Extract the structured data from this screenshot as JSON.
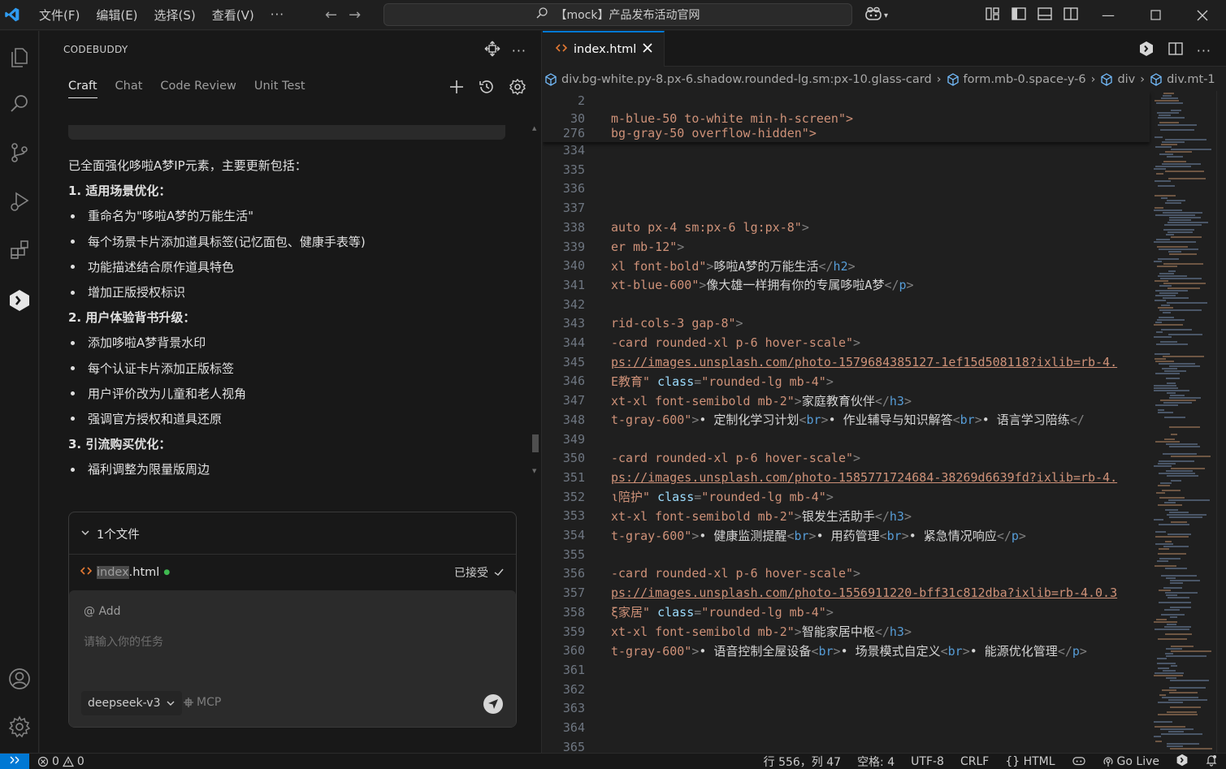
{
  "titlebar": {
    "menus": [
      "文件(F)",
      "编辑(E)",
      "选择(S)",
      "查看(V)"
    ],
    "more": "···",
    "search_text": "【mock】产品发布活动官网",
    "icons": [
      "vscode-logo",
      "back-arrow",
      "forward-arrow",
      "search",
      "copilot",
      "layout-customize",
      "toggle-primary-sidebar",
      "toggle-panel",
      "toggle-secondary-sidebar"
    ],
    "window_controls": [
      "minimize",
      "maximize",
      "close"
    ]
  },
  "activity_bar": {
    "items": [
      "explorer",
      "search",
      "source-control",
      "run-and-debug",
      "extensions",
      "codebuddy",
      "accounts",
      "manage"
    ]
  },
  "panel": {
    "title": "CODEBUDDY",
    "tabs": [
      "Craft",
      "Chat",
      "Code Review",
      "Unit Test"
    ],
    "active_tab": "Craft",
    "message": {
      "intro": "已全面强化哆啦A梦IP元素，主要更新包括：",
      "sections": [
        {
          "heading": "1. 适用场景优化：",
          "items": [
            "重命名为\"哆啦A梦的万能生活\"",
            "每个场景卡片添加道具标签(记忆面包、健康手表等)",
            "功能描述结合原作道具特色",
            "增加正版授权标识"
          ]
        },
        {
          "heading": "2. 用户体验背书升级：",
          "items": [
            "添加哆啦A梦背景水印",
            "每个认证卡片添加正版标签",
            "用户评价改为儿童和老人视角",
            "强调官方授权和道具还原"
          ]
        },
        {
          "heading": "3. 引流购买优化：",
          "items": [
            "福利调整为限量版周边"
          ]
        }
      ]
    },
    "files": {
      "header": "1个文件",
      "file_name_highlight": "index",
      "file_name_rest": ".html",
      "status": "已接受"
    },
    "input": {
      "at_label": "@ Add",
      "placeholder": "请输入你的任务",
      "model": "deepseek-v3",
      "mcp": "MCP"
    }
  },
  "editor": {
    "tab_label": "index.html",
    "breadcrumb": [
      "div.bg-white.py-8.px-6.shadow.rounded-lg.sm:px-10.glass-card",
      "form.mb-0.space-y-6",
      "div",
      "div.mt-1"
    ],
    "sticky": [
      {
        "ln": "2",
        "text": ""
      },
      {
        "ln": "30",
        "text": "m-blue-50 to-white min-h-screen\">"
      },
      {
        "ln": "276",
        "text": "bg-gray-50 overflow-hidden\">"
      }
    ],
    "lines": [
      {
        "ln": "334",
        "parts": []
      },
      {
        "ln": "335",
        "parts": []
      },
      {
        "ln": "336",
        "parts": []
      },
      {
        "ln": "337",
        "parts": []
      },
      {
        "ln": "338",
        "parts": [
          [
            "str",
            "auto px-4 sm:px-6 lg:px-8\""
          ],
          [
            "punc",
            ">"
          ]
        ]
      },
      {
        "ln": "339",
        "parts": [
          [
            "str",
            "er mb-12\""
          ],
          [
            "punc",
            ">"
          ]
        ]
      },
      {
        "ln": "340",
        "parts": [
          [
            "str",
            "xl font-bold\""
          ],
          [
            "punc",
            ">"
          ],
          [
            "text",
            "哆啦A梦的万能生活"
          ],
          [
            "punc",
            "</"
          ],
          [
            "tag",
            "h2"
          ],
          [
            "punc",
            ">"
          ]
        ]
      },
      {
        "ln": "341",
        "parts": [
          [
            "str",
            "xt-blue-600\""
          ],
          [
            "punc",
            ">"
          ],
          [
            "text",
            "像大雄一样拥有你的专属哆啦A梦"
          ],
          [
            "punc",
            "</"
          ],
          [
            "tag",
            "p"
          ],
          [
            "punc",
            ">"
          ]
        ]
      },
      {
        "ln": "342",
        "parts": []
      },
      {
        "ln": "343",
        "parts": [
          [
            "str",
            "rid-cols-3 gap-8\""
          ],
          [
            "punc",
            ">"
          ]
        ]
      },
      {
        "ln": "344",
        "parts": [
          [
            "str",
            "-card rounded-xl p-6 hover-scale\""
          ],
          [
            "punc",
            ">"
          ]
        ]
      },
      {
        "ln": "345",
        "parts": [
          [
            "link",
            "ps://images.unsplash.com/photo-1579684385127-1ef15d508118?ixlib=rb-4."
          ]
        ]
      },
      {
        "ln": "346",
        "parts": [
          [
            "str",
            "Ε教育\" "
          ],
          [
            "attr",
            "class"
          ],
          [
            "punc",
            "="
          ],
          [
            "str",
            "\"rounded-lg mb-4\""
          ],
          [
            "punc",
            ">"
          ]
        ]
      },
      {
        "ln": "347",
        "parts": [
          [
            "str",
            "xt-xl font-semibold mb-2\""
          ],
          [
            "punc",
            ">"
          ],
          [
            "text",
            "家庭教育伙伴"
          ],
          [
            "punc",
            "</"
          ],
          [
            "tag",
            "h3"
          ],
          [
            "punc",
            ">"
          ]
        ]
      },
      {
        "ln": "348",
        "parts": [
          [
            "str",
            "t-gray-600\""
          ],
          [
            "punc",
            ">"
          ],
          [
            "text",
            "• 定制化学习计划"
          ],
          [
            "punc",
            "<"
          ],
          [
            "tag",
            "br"
          ],
          [
            "punc",
            ">"
          ],
          [
            "text",
            "• 作业辅导与知识解答"
          ],
          [
            "punc",
            "<"
          ],
          [
            "tag",
            "br"
          ],
          [
            "punc",
            ">"
          ],
          [
            "text",
            "• 语言学习陪练"
          ],
          [
            "punc",
            "</"
          ]
        ]
      },
      {
        "ln": "349",
        "parts": []
      },
      {
        "ln": "350",
        "parts": [
          [
            "str",
            "-card rounded-xl p-6 hover-scale\""
          ],
          [
            "punc",
            ">"
          ]
        ]
      },
      {
        "ln": "351",
        "parts": [
          [
            "link",
            "ps://images.unsplash.com/photo-1585771724684-38269d6639fd?ixlib=rb-4."
          ]
        ]
      },
      {
        "ln": "352",
        "parts": [
          [
            "str",
            "ι陪护\" "
          ],
          [
            "attr",
            "class"
          ],
          [
            "punc",
            "="
          ],
          [
            "str",
            "\"rounded-lg mb-4\""
          ],
          [
            "punc",
            ">"
          ]
        ]
      },
      {
        "ln": "353",
        "parts": [
          [
            "str",
            "xt-xl font-semibold mb-2\""
          ],
          [
            "punc",
            ">"
          ],
          [
            "text",
            "银发生活助手"
          ],
          [
            "punc",
            "</"
          ],
          [
            "tag",
            "h3"
          ],
          [
            "punc",
            ">"
          ]
        ]
      },
      {
        "ln": "354",
        "parts": [
          [
            "str",
            "t-gray-600\""
          ],
          [
            "punc",
            ">"
          ],
          [
            "text",
            "• 健康监测提醒"
          ],
          [
            "punc",
            "<"
          ],
          [
            "tag",
            "br"
          ],
          [
            "punc",
            ">"
          ],
          [
            "text",
            "• 用药管理"
          ],
          [
            "punc",
            "<"
          ],
          [
            "tag",
            "br"
          ],
          [
            "punc",
            ">"
          ],
          [
            "text",
            "• 紧急情况响应"
          ],
          [
            "punc",
            "</"
          ],
          [
            "tag",
            "p"
          ],
          [
            "punc",
            ">"
          ]
        ]
      },
      {
        "ln": "355",
        "parts": []
      },
      {
        "ln": "356",
        "parts": [
          [
            "str",
            "-card rounded-xl p-6 hover-scale\""
          ],
          [
            "punc",
            ">"
          ]
        ]
      },
      {
        "ln": "357",
        "parts": [
          [
            "link",
            "ps://images.unsplash.com/photo-1556911220-bff31c812dba?ixlib=rb-4.0.3"
          ]
        ]
      },
      {
        "ln": "358",
        "parts": [
          [
            "str",
            "ξ家居\" "
          ],
          [
            "attr",
            "class"
          ],
          [
            "punc",
            "="
          ],
          [
            "str",
            "\"rounded-lg mb-4\""
          ],
          [
            "punc",
            ">"
          ]
        ]
      },
      {
        "ln": "359",
        "parts": [
          [
            "str",
            "xt-xl font-semibold mb-2\""
          ],
          [
            "punc",
            ">"
          ],
          [
            "text",
            "智能家居中枢"
          ],
          [
            "punc",
            "</"
          ],
          [
            "tag",
            "h3"
          ],
          [
            "punc",
            ">"
          ]
        ]
      },
      {
        "ln": "360",
        "parts": [
          [
            "str",
            "t-gray-600\""
          ],
          [
            "punc",
            ">"
          ],
          [
            "text",
            "• 语音控制全屋设备"
          ],
          [
            "punc",
            "<"
          ],
          [
            "tag",
            "br"
          ],
          [
            "punc",
            ">"
          ],
          [
            "text",
            "• 场景模式自定义"
          ],
          [
            "punc",
            "<"
          ],
          [
            "tag",
            "br"
          ],
          [
            "punc",
            ">"
          ],
          [
            "text",
            "• 能源优化管理"
          ],
          [
            "punc",
            "</"
          ],
          [
            "tag",
            "p"
          ],
          [
            "punc",
            ">"
          ]
        ]
      },
      {
        "ln": "361",
        "parts": []
      },
      {
        "ln": "362",
        "parts": []
      },
      {
        "ln": "363",
        "parts": []
      },
      {
        "ln": "364",
        "parts": []
      },
      {
        "ln": "365",
        "parts": []
      }
    ]
  },
  "statusbar": {
    "errors": "0",
    "warnings": "0",
    "position": "行 556，列 47",
    "spaces": "空格: 4",
    "encoding": "UTF-8",
    "eol": "CRLF",
    "language": "{} HTML",
    "go_live": "Go Live"
  },
  "colors": {
    "accent": "#0078d4",
    "background": "#1f1f1f",
    "sidebar": "#181818"
  }
}
